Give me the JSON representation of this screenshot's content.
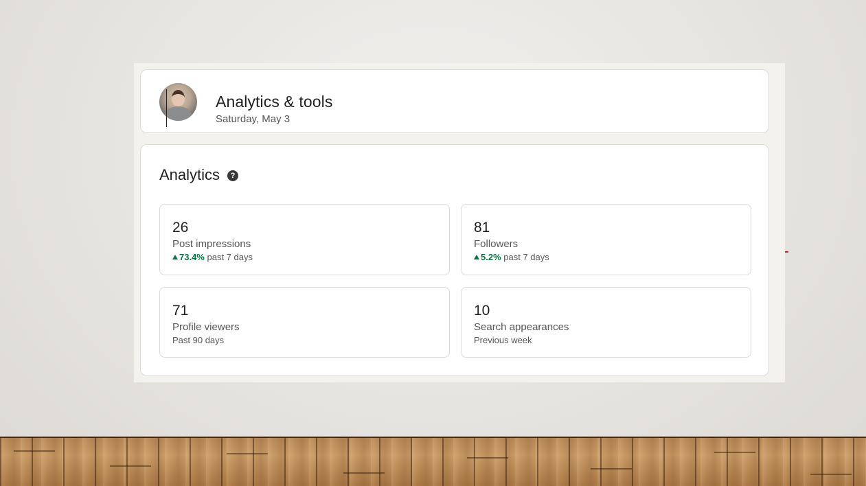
{
  "header": {
    "title": "Analytics & tools",
    "date": "Saturday, May 3"
  },
  "analytics": {
    "title": "Analytics",
    "help_icon": "question-circle-icon",
    "stats": [
      {
        "value": "26",
        "label": "Post impressions",
        "trend": "73.4%",
        "trend_period": "past 7 days",
        "trend_direction": "up"
      },
      {
        "value": "81",
        "label": "Followers",
        "trend": "5.2%",
        "trend_period": "past 7 days",
        "trend_direction": "up"
      },
      {
        "value": "71",
        "label": "Profile viewers",
        "period": "Past 90 days"
      },
      {
        "value": "10",
        "label": "Search appearances",
        "period": "Previous week"
      }
    ]
  },
  "colors": {
    "trend_positive": "#057642",
    "card_background": "#ffffff",
    "slide_background": "#f3f2ef"
  }
}
